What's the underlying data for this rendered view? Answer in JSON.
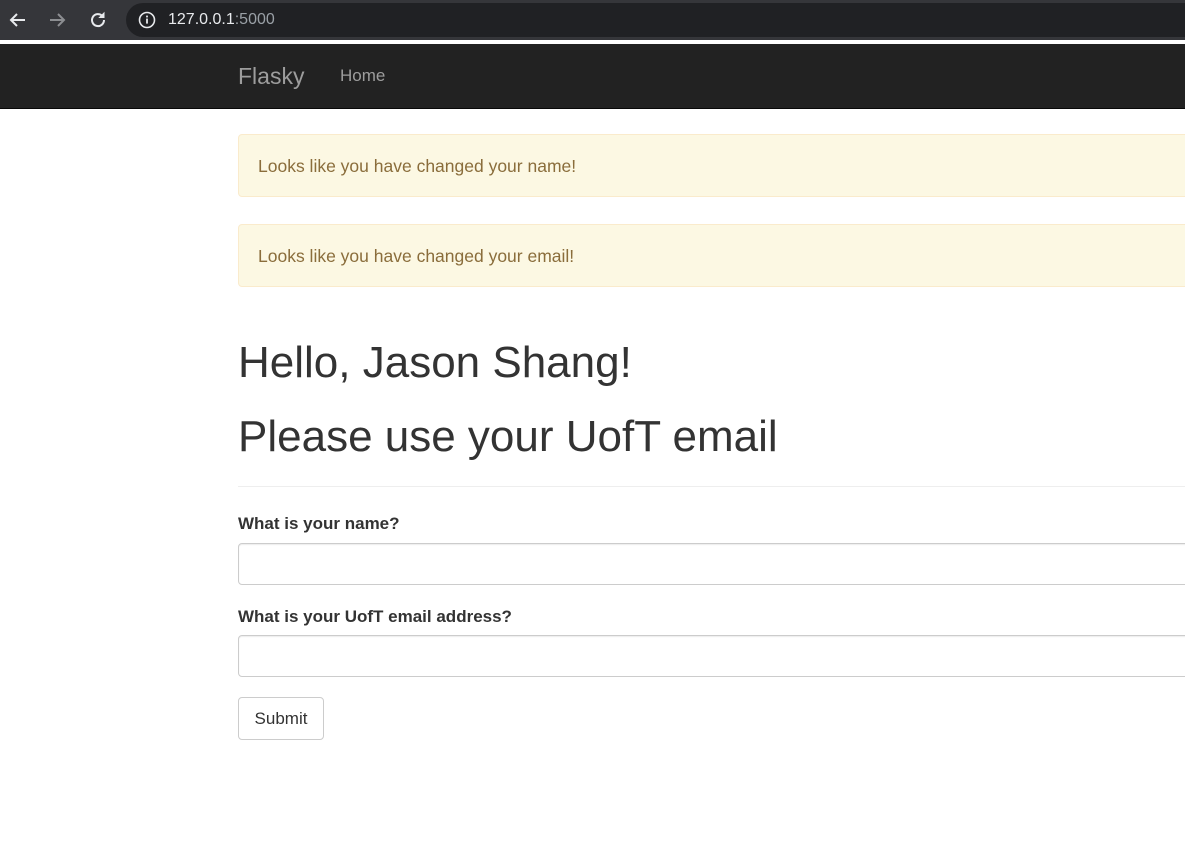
{
  "browser": {
    "url_host": "127.0.0.1",
    "url_port": ":5000",
    "back_icon": "arrow-left-icon",
    "forward_icon": "arrow-right-icon",
    "reload_icon": "reload-icon",
    "info_icon": "info-icon"
  },
  "navbar": {
    "brand": "Flasky",
    "links": [
      {
        "label": "Home"
      }
    ]
  },
  "alerts": [
    {
      "message": "Looks like you have changed your name!"
    },
    {
      "message": "Looks like you have changed your email!"
    }
  ],
  "page": {
    "greeting": "Hello, Jason Shang!",
    "notice": "Please use your UofT email"
  },
  "form": {
    "name_label": "What is your name?",
    "name_value": "",
    "email_label": "What is your UofT email address?",
    "email_value": "",
    "submit_label": "Submit"
  },
  "colors": {
    "navbar_bg": "#222222",
    "alert_bg": "#fcf8e3",
    "alert_text": "#8a6d3b",
    "heading_text": "#333333"
  }
}
